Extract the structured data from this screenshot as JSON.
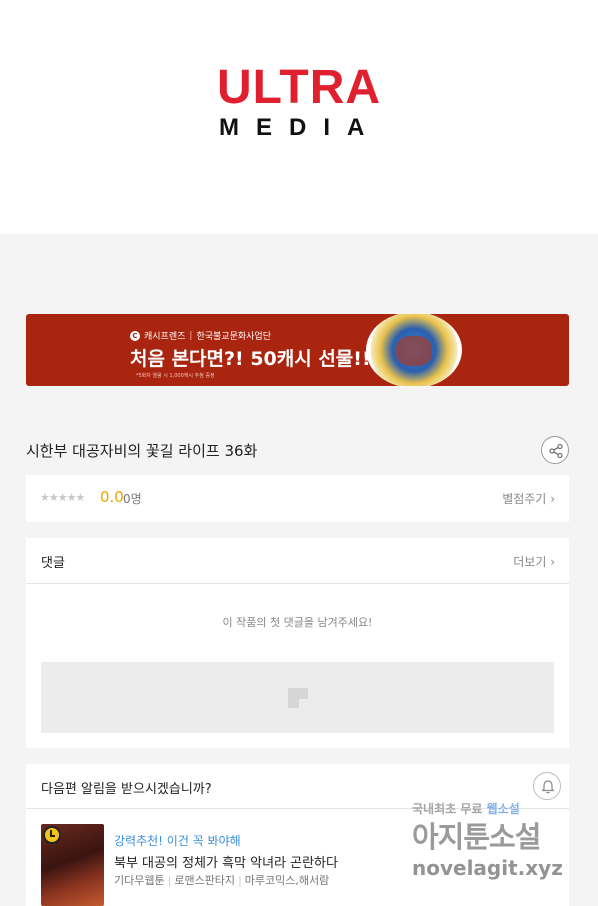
{
  "header": {
    "logo_top": "ULTRA",
    "logo_bottom": "MEDIA"
  },
  "banner": {
    "brand": "캐시프렌즈",
    "partner": "한국불교문화사업단",
    "headline": "처음 본다면?! 50캐시 선물!!",
    "fine_print": "*5화차 열람 시 1,000캐시 추첨 증정"
  },
  "episode": {
    "title": "시한부 대공자비의 꽃길 라이프 36화"
  },
  "rating": {
    "stars": "★★★★★",
    "score": "0.0",
    "voters": "0명",
    "rate_label": "별점주기"
  },
  "comments": {
    "title": "댓글",
    "more_label": "더보기",
    "empty_text": "이 작품의 첫 댓글을 남겨주세요!"
  },
  "notify": {
    "title": "다음편 알림을 받으시겠습니까?"
  },
  "recommendation": {
    "tag": "강력추천! 이건 꼭 봐야해",
    "name": "북부 대공의 정체가 흑막 악녀라 곤란하다",
    "meta": [
      "기다무웹툰",
      "로맨스판타지",
      "마루코믹스,해서람"
    ]
  },
  "watermark": {
    "line1_prefix": "국내최초 무료",
    "line1_highlight": "웹소설",
    "line2": "아지툰소설",
    "line3": "novelagit.xyz"
  },
  "colors": {
    "brand_red": "#e0202e",
    "banner_bg": "#a9250f",
    "score": "#e8a800",
    "tag_blue": "#3b8fd9"
  }
}
